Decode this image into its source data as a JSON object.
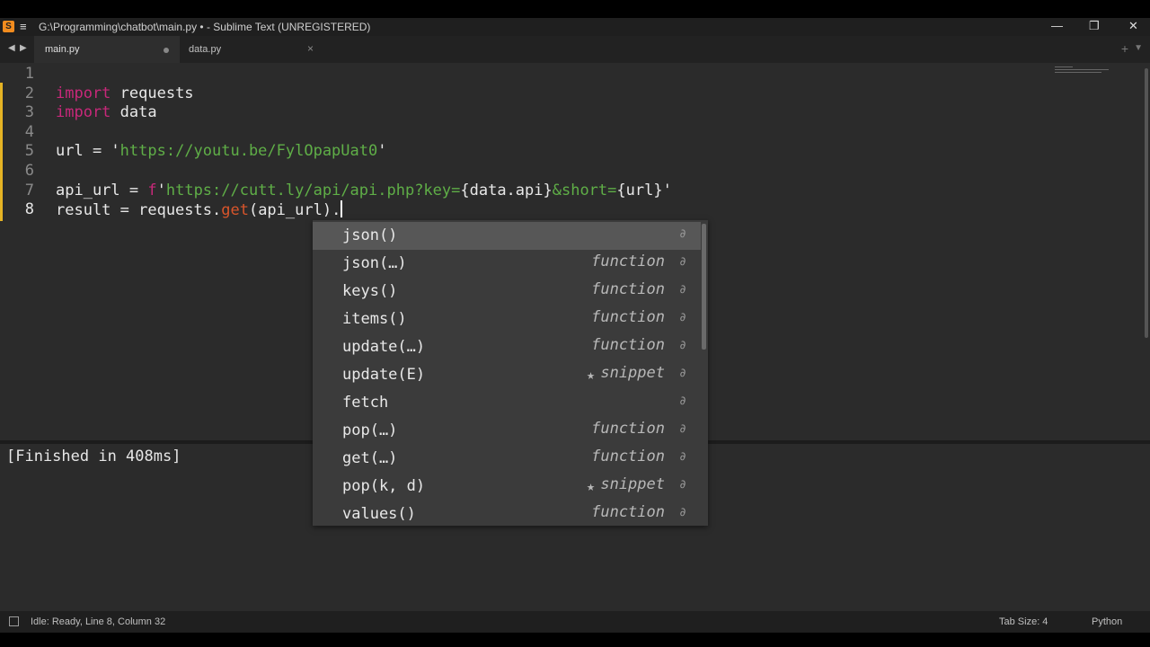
{
  "titlebar": {
    "title": "G:\\Programming\\chatbot\\main.py • - Sublime Text (UNREGISTERED)",
    "app_icon": "sublime-logo",
    "minimize": "—",
    "restore": "❐",
    "close": "✕"
  },
  "tabs": [
    {
      "label": "main.py",
      "modified": true
    },
    {
      "label": "data.py",
      "modified": false
    }
  ],
  "editor": {
    "lines": [
      {
        "n": "1",
        "parts": []
      },
      {
        "n": "2",
        "parts": [
          {
            "t": "import",
            "c": "kw"
          },
          {
            "t": " requests",
            "c": ""
          }
        ]
      },
      {
        "n": "3",
        "parts": [
          {
            "t": "import",
            "c": "kw"
          },
          {
            "t": " data",
            "c": ""
          }
        ]
      },
      {
        "n": "4",
        "parts": []
      },
      {
        "n": "5",
        "parts": [
          {
            "t": "url = '",
            "c": ""
          },
          {
            "t": "https://youtu.be/FylOpapUat0",
            "c": "str"
          },
          {
            "t": "'",
            "c": ""
          }
        ]
      },
      {
        "n": "6",
        "parts": []
      },
      {
        "n": "7",
        "parts": [
          {
            "t": "api_url = ",
            "c": ""
          },
          {
            "t": "f",
            "c": "kw"
          },
          {
            "t": "'",
            "c": ""
          },
          {
            "t": "https://cutt.ly/api/api.php?key=",
            "c": "str"
          },
          {
            "t": "{data.api}",
            "c": ""
          },
          {
            "t": "&short=",
            "c": "str"
          },
          {
            "t": "{url}'",
            "c": ""
          }
        ]
      },
      {
        "n": "8",
        "parts": [
          {
            "t": "result = requests.",
            "c": ""
          },
          {
            "t": "get",
            "c": "fn"
          },
          {
            "t": "(api_url).",
            "c": ""
          }
        ]
      }
    ]
  },
  "autocomplete": [
    {
      "name": "json()",
      "kind": "",
      "star": false,
      "selected": true
    },
    {
      "name": "json(…)",
      "kind": "function",
      "star": false,
      "selected": false
    },
    {
      "name": "keys()",
      "kind": "function",
      "star": false,
      "selected": false
    },
    {
      "name": "items()",
      "kind": "function",
      "star": false,
      "selected": false
    },
    {
      "name": "update(…)",
      "kind": "function",
      "star": false,
      "selected": false
    },
    {
      "name": "update(E)",
      "kind": "snippet",
      "star": true,
      "selected": false
    },
    {
      "name": "fetch",
      "kind": "",
      "star": false,
      "selected": false
    },
    {
      "name": "pop(…)",
      "kind": "function",
      "star": false,
      "selected": false
    },
    {
      "name": "get(…)",
      "kind": "function",
      "star": false,
      "selected": false
    },
    {
      "name": "pop(k, d)",
      "kind": "snippet",
      "star": true,
      "selected": false
    },
    {
      "name": "values()",
      "kind": "function",
      "star": false,
      "selected": false
    }
  ],
  "output": {
    "text": "[Finished in 408ms]"
  },
  "statusbar": {
    "status": "Idle: Ready, Line 8, Column 32",
    "tab_size": "Tab Size: 4",
    "syntax": "Python"
  },
  "colors": {
    "keyword": "#c8287a",
    "string": "#5fae47",
    "function": "#d9552b",
    "modified_marker": "#e5b324"
  }
}
